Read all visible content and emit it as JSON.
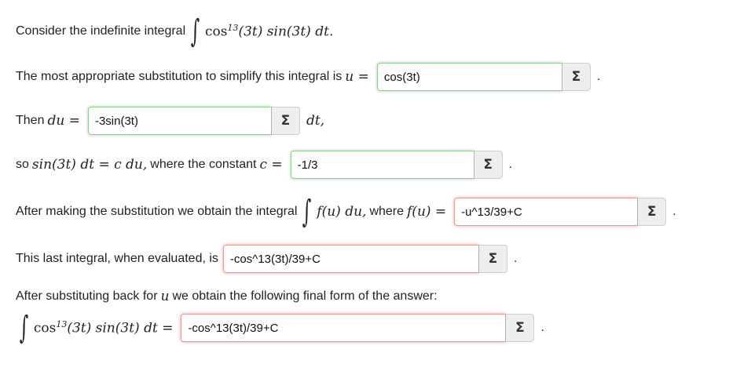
{
  "q1": {
    "text": "Consider the indefinite integral",
    "func": "cos",
    "exp": "13",
    "args": "(3t) sin(3t) dt",
    "end": "."
  },
  "q2": {
    "text": "The most appropriate substitution to simplify this integral is",
    "var": "u =",
    "value": "cos(3t)",
    "sigma": "Σ",
    "end": "."
  },
  "q3": {
    "text": "Then",
    "var": "du =",
    "value": "-3sin(3t)",
    "sigma": "Σ",
    "after": "dt,"
  },
  "q4": {
    "text_a": "so",
    "math_a": "sin(3t) dt = c du,",
    "text_b": "where the constant",
    "var": "c =",
    "value": "-1/3",
    "sigma": "Σ",
    "end": "."
  },
  "q5": {
    "text": "After making the substitution we obtain the integral",
    "math_a": "f(u) du,",
    "text_b": "where",
    "var": "f(u) =",
    "value": "-u^13/39+C",
    "sigma": "Σ",
    "end": "."
  },
  "q6": {
    "text": "This last integral, when evaluated, is",
    "value": "-cos^13(3t)/39+C",
    "sigma": "Σ",
    "end": "."
  },
  "q7": {
    "text_a": "After substituting back for",
    "var": "u",
    "text_b": "we obtain the following final form of the answer:"
  },
  "q8": {
    "func": "cos",
    "exp": "13",
    "args": "(3t) sin(3t) dt =",
    "value": "-cos^13(3t)/39+C",
    "sigma": "Σ",
    "end": "."
  }
}
